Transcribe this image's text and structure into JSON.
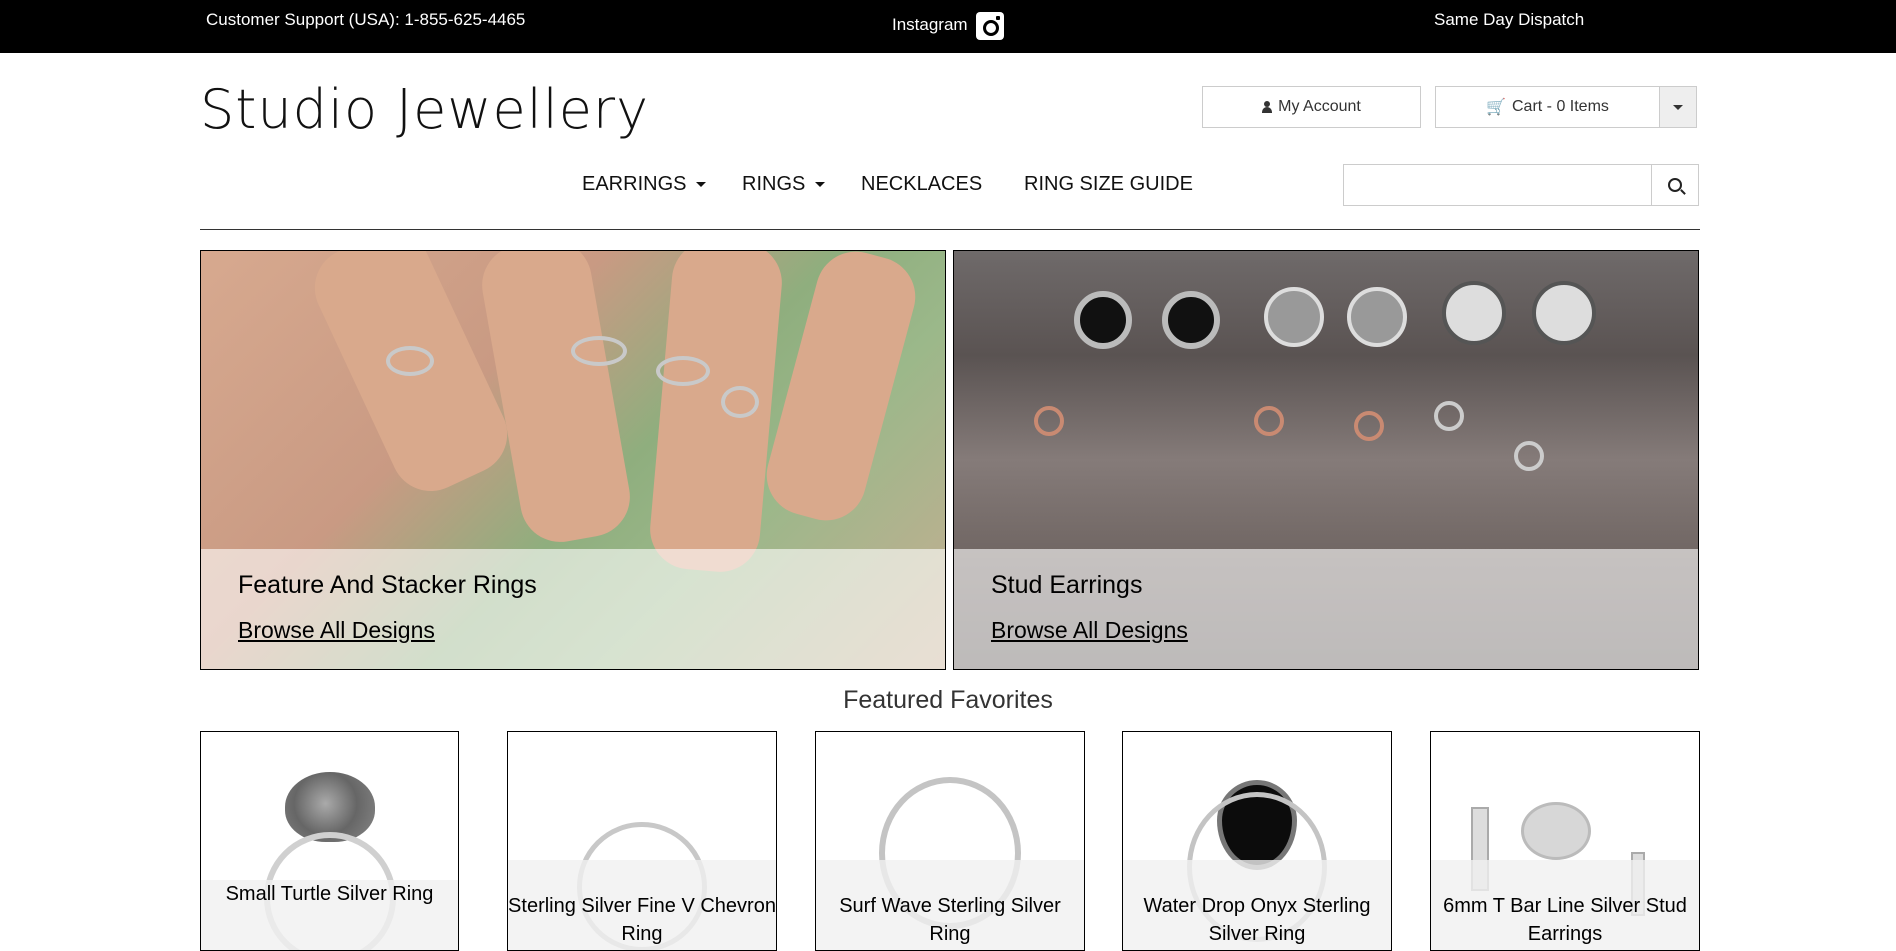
{
  "topbar": {
    "support": "Customer Support (USA): 1-855-625-4465",
    "instagram": "Instagram",
    "dispatch": "Same Day Dispatch"
  },
  "header": {
    "logo": "Studio Jewellery",
    "account_label": "My Account",
    "cart_label": "Cart - 0 Items"
  },
  "nav": {
    "items": [
      {
        "label": "EARRINGS"
      },
      {
        "label": "RINGS"
      },
      {
        "label": "NECKLACES"
      },
      {
        "label": "RING SIZE GUIDE"
      }
    ]
  },
  "search": {
    "placeholder": ""
  },
  "banners": [
    {
      "title": "Feature And Stacker Rings",
      "link": "Browse All Designs"
    },
    {
      "title": "Stud Earrings",
      "link": "Browse All Designs"
    }
  ],
  "featured": {
    "title": "Featured Favorites",
    "products": [
      {
        "name": "Small Turtle Silver Ring"
      },
      {
        "name": "Sterling Silver Fine V Chevron Ring"
      },
      {
        "name": "Surf Wave Sterling Silver Ring"
      },
      {
        "name": "Water Drop Onyx Sterling Silver Ring"
      },
      {
        "name": "6mm T Bar Line Silver Stud Earrings"
      }
    ]
  }
}
